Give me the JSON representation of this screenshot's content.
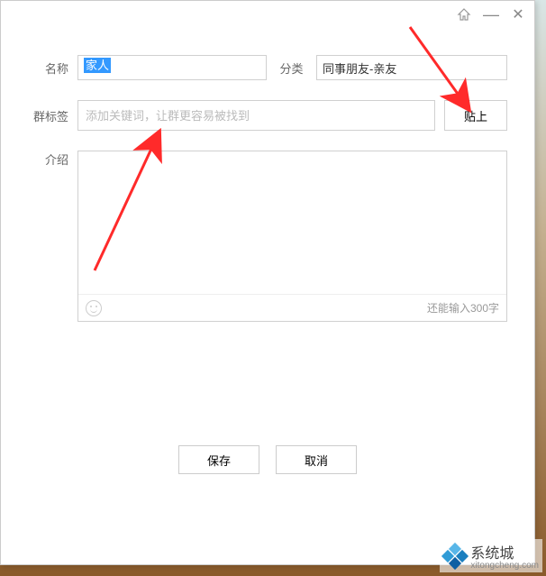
{
  "titlebar": {
    "home_icon": "home-icon",
    "min_icon": "minimize-icon",
    "close_icon": "close-icon"
  },
  "form": {
    "name_label": "名称",
    "name_value": "家人",
    "category_label": "分类",
    "category_value": "同事朋友-亲友",
    "tags_label": "群标签",
    "tags_placeholder": "添加关键词，让群更容易被找到",
    "paste_button": "贴上",
    "intro_label": "介绍",
    "char_counter": "还能输入300字"
  },
  "buttons": {
    "save": "保存",
    "cancel": "取消"
  },
  "watermark": {
    "title": "系统城",
    "sub": "xitongcheng.com"
  }
}
